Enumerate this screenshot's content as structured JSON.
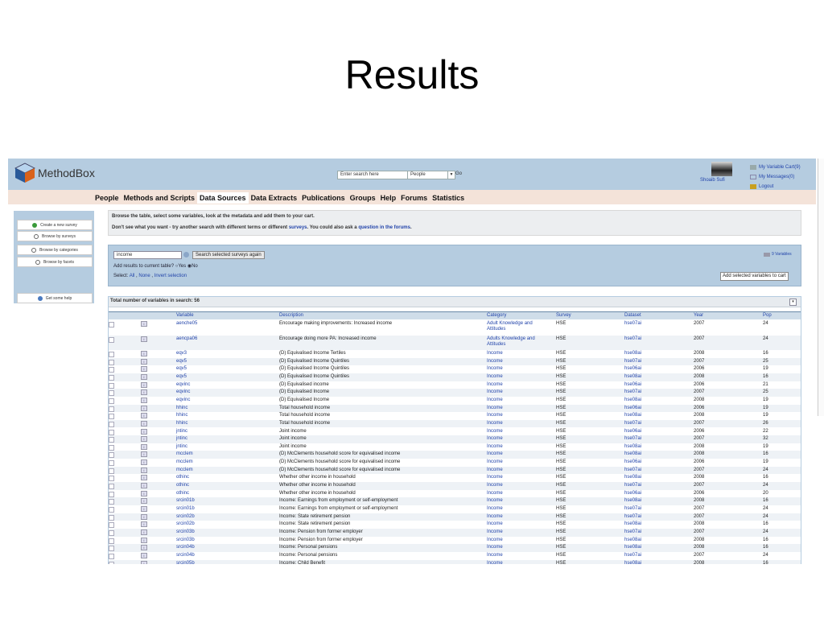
{
  "slide": {
    "title": "Results"
  },
  "app": {
    "logo_text": "MethodBox",
    "search_placeholder": "Enter search here",
    "search_scope": "People",
    "go_label": "Go",
    "user_name": "Shoaib Sufi",
    "links": [
      {
        "label": "My Variable Cart(9)",
        "icon": "cart-icon"
      },
      {
        "label": "My Messages(0)",
        "icon": "mail-icon"
      },
      {
        "label": "Logout",
        "icon": "logout-icon"
      }
    ],
    "nav": [
      {
        "label": "People",
        "active": false
      },
      {
        "label": "Methods and Scripts",
        "active": false
      },
      {
        "label": "Data Sources",
        "active": true
      },
      {
        "label": "Data Extracts",
        "active": false
      },
      {
        "label": "Publications",
        "active": false
      },
      {
        "label": "Groups",
        "active": false
      },
      {
        "label": "Help",
        "active": false
      },
      {
        "label": "Forums",
        "active": false
      },
      {
        "label": "Statistics",
        "active": false
      }
    ]
  },
  "sidebar": {
    "items": [
      {
        "label": "Create a new survey",
        "icon": "plus-icon"
      },
      {
        "label": "Browse by surveys",
        "icon": "magnifier-icon"
      },
      {
        "label": "Browse by categories",
        "icon": "magnifier-icon"
      },
      {
        "label": "Browse by facets",
        "icon": "magnifier-icon"
      }
    ],
    "help_label": "Get some help"
  },
  "info": {
    "line1": "Browse the table, select some variables, look at the metadata and add them to your cart.",
    "line2_pre": "Don't see what you want - try another search with different terms or different",
    "line2_link1": "surveys",
    "line2_mid": ". You could also ask a",
    "line2_link2": "question in the forums",
    "line2_post": "."
  },
  "search_panel": {
    "query": "income",
    "search_button": "Search selected surveys again",
    "add_results_label": "Add results to current table?",
    "yes_label": "Yes",
    "no_label": "No",
    "select_label": "Select:",
    "select_all": "All",
    "select_none": "None",
    "invert": "Invert selection",
    "variables_label": "9 Variables",
    "add_button": "Add selected variables to cart"
  },
  "results": {
    "total_label": "Total number of variables in search: 56",
    "columns": [
      "Variable",
      "Description",
      "Category",
      "Survey",
      "Dataset",
      "Year",
      "Pop"
    ],
    "rows": [
      [
        "aenche05",
        "Encourage making improvements: Increased income",
        "Adult Knowledge and Attitudes",
        "HSE",
        "hse07ai",
        "2007",
        "24"
      ],
      [
        "aencpa06",
        "Encourage doing more PA: Increased income",
        "Adults Knowledge and Attitudes",
        "HSE",
        "hse07ai",
        "2007",
        "24"
      ],
      [
        "eqv3",
        "(D) Equivalised Income Tertiles",
        "Income",
        "HSE",
        "hse08ai",
        "2008",
        "16"
      ],
      [
        "eqv5",
        "(D) Equivalised Income Quintiles",
        "Income",
        "HSE",
        "hse07ai",
        "2007",
        "25"
      ],
      [
        "eqv5",
        "(D) Equivalised Income Quintiles",
        "Income",
        "HSE",
        "hse06ai",
        "2006",
        "19"
      ],
      [
        "eqv5",
        "(D) Equivalised Income Quintiles",
        "Income",
        "HSE",
        "hse08ai",
        "2008",
        "16"
      ],
      [
        "eqvinc",
        "(D) Equivalised income",
        "Income",
        "HSE",
        "hse06ai",
        "2006",
        "21"
      ],
      [
        "eqvinc",
        "(D) Equivalised Income",
        "Income",
        "HSE",
        "hse07ai",
        "2007",
        "25"
      ],
      [
        "eqvinc",
        "(D) Equivalised Income",
        "Income",
        "HSE",
        "hse08ai",
        "2008",
        "19"
      ],
      [
        "hhinc",
        "Total household income",
        "Income",
        "HSE",
        "hse06ai",
        "2006",
        "19"
      ],
      [
        "hhinc",
        "Total household income",
        "Income",
        "HSE",
        "hse08ai",
        "2008",
        "19"
      ],
      [
        "hhinc",
        "Total household income",
        "Income",
        "HSE",
        "hse07ai",
        "2007",
        "26"
      ],
      [
        "jntinc",
        "Joint income",
        "Income",
        "HSE",
        "hse06ai",
        "2006",
        "22"
      ],
      [
        "jntinc",
        "Joint income",
        "Income",
        "HSE",
        "hse07ai",
        "2007",
        "32"
      ],
      [
        "jntinc",
        "Joint income",
        "Income",
        "HSE",
        "hse08ai",
        "2008",
        "19"
      ],
      [
        "mcclem",
        "(D) McClements household score for equivalised income",
        "Income",
        "HSE",
        "hse08ai",
        "2008",
        "16"
      ],
      [
        "mcclem",
        "(D) McClements household score for equivalised income",
        "Income",
        "HSE",
        "hse06ai",
        "2006",
        "19"
      ],
      [
        "mcclem",
        "(D) McClements household score for equivalised income",
        "Income",
        "HSE",
        "hse07ai",
        "2007",
        "24"
      ],
      [
        "othinc",
        "Whether other income in household",
        "Income",
        "HSE",
        "hse08ai",
        "2008",
        "16"
      ],
      [
        "othinc",
        "Whether other income in household",
        "Income",
        "HSE",
        "hse07ai",
        "2007",
        "24"
      ],
      [
        "othinc",
        "Whether other income in household",
        "Income",
        "HSE",
        "hse06ai",
        "2006",
        "20"
      ],
      [
        "srcin01b",
        "Income: Earnings from employment or self-employment",
        "Income",
        "HSE",
        "hse08ai",
        "2008",
        "16"
      ],
      [
        "srcin01b",
        "Income: Earnings from employment or self-employment",
        "Income",
        "HSE",
        "hse07ai",
        "2007",
        "24"
      ],
      [
        "srcin02b",
        "Income: State retirement pension",
        "Income",
        "HSE",
        "hse07ai",
        "2007",
        "24"
      ],
      [
        "srcin02b",
        "Income: State retirement pension",
        "Income",
        "HSE",
        "hse08ai",
        "2008",
        "16"
      ],
      [
        "srcin03b",
        "Income: Pension from former employer",
        "Income",
        "HSE",
        "hse07ai",
        "2007",
        "24"
      ],
      [
        "srcin03b",
        "Income: Pension from former employer",
        "Income",
        "HSE",
        "hse08ai",
        "2008",
        "16"
      ],
      [
        "srcin04b",
        "Income: Personal pensions",
        "Income",
        "HSE",
        "hse08ai",
        "2008",
        "16"
      ],
      [
        "srcin04b",
        "Income: Personal pensions",
        "Income",
        "HSE",
        "hse07ai",
        "2007",
        "24"
      ],
      [
        "srcin05b",
        "Income: Child Benefit",
        "Income",
        "HSE",
        "hse08ai",
        "2008",
        "16"
      ]
    ]
  }
}
